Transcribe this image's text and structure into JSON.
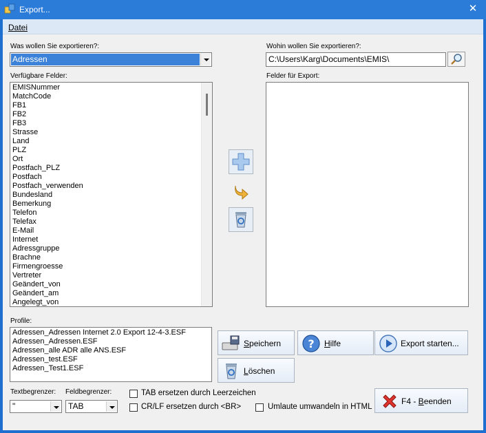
{
  "window": {
    "title": "Export..."
  },
  "menu": {
    "items": [
      "Datei"
    ]
  },
  "source": {
    "label": "Was wollen Sie exportieren?:",
    "selected": "Adressen"
  },
  "target": {
    "label": "Wohin wollen Sie exportieren?:",
    "path": "C:\\Users\\Karg\\Documents\\EMIS\\"
  },
  "available_fields": {
    "label": "Verfügbare Felder:",
    "items": [
      "EMISNummer",
      "MatchCode",
      "FB1",
      "FB2",
      "FB3",
      "Strasse",
      "Land",
      "PLZ",
      "Ort",
      "Postfach_PLZ",
      "Postfach",
      "Postfach_verwenden",
      "Bundesland",
      "Bemerkung",
      "Telefon",
      "Telefax",
      "E-Mail",
      "Internet",
      "Adressgruppe",
      "Brachne",
      "Firmengroesse",
      "Vertreter",
      "Geändert_von",
      "Geändert_am",
      "Angelegt_von"
    ]
  },
  "export_fields": {
    "label": "Felder für Export:",
    "items": []
  },
  "profiles": {
    "label": "Profile:",
    "items": [
      "Adressen_Adressen Internet 2.0 Export 12-4-3.ESF",
      "Adressen_Adressen.ESF",
      "Adressen_alle ADR alle ANS.ESF",
      "Adressen_test.ESF",
      "Adressen_Test1.ESF"
    ]
  },
  "buttons": {
    "save": "Speichern",
    "help": "Hilfe",
    "start": "Export starten...",
    "delete": "Löschen",
    "quit_prefix": "F4 - ",
    "quit": "Beenden"
  },
  "delimiters": {
    "text_label": "Textbegrenzer:",
    "text_value": "\"",
    "field_label": "Feldbegrenzer:",
    "field_value": "TAB"
  },
  "options": {
    "tab_replace": "TAB ersetzen durch Leerzeichen",
    "crlf_replace": "CR/LF ersetzen durch <BR>",
    "umlaute": "Umlaute umwandeln in HTML"
  },
  "colors": {
    "titlebar": "#2b7bd8",
    "selection": "#3b82d8",
    "window_bg": "#f0f0f0"
  },
  "icons": {
    "add": "plus-icon",
    "move": "curved-arrow-icon",
    "remove": "recycle-bin-icon",
    "save": "floppy-printer-icon",
    "help": "help-question-icon",
    "start": "play-icon",
    "delete": "recycle-bin-icon",
    "quit": "red-x-icon"
  }
}
